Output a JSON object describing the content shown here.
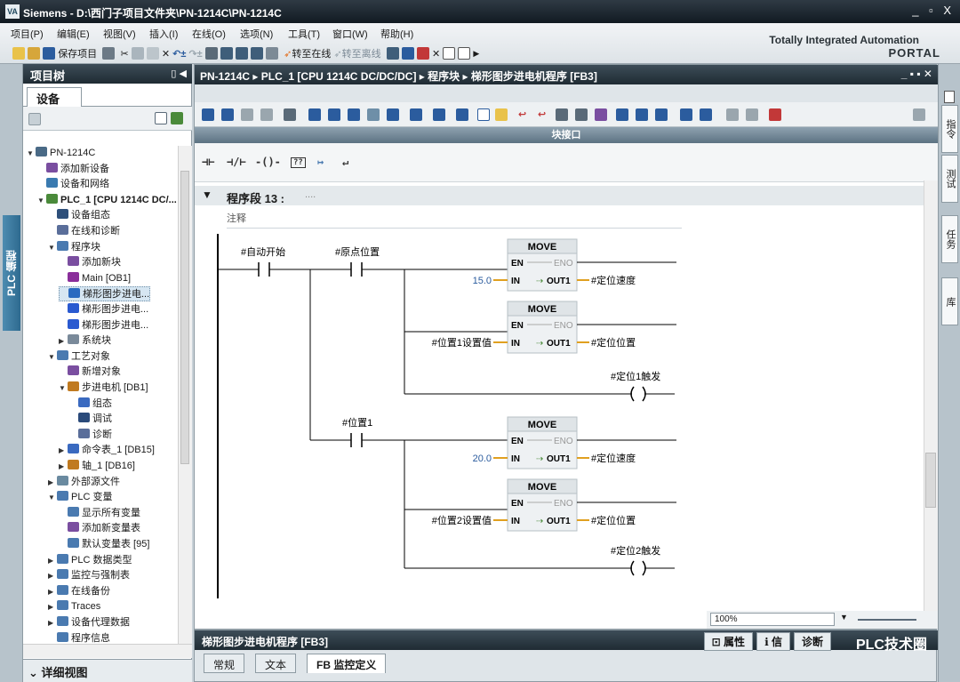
{
  "window": {
    "app": "Siemens",
    "path": "D:\\西门子项目文件夹\\PN-1214C\\PN-1214C",
    "logo": "VA",
    "controls": "_ ▫ X"
  },
  "menu": [
    "项目(P)",
    "编辑(E)",
    "视图(V)",
    "插入(I)",
    "在线(O)",
    "选项(N)",
    "工具(T)",
    "窗口(W)",
    "帮助(H)"
  ],
  "toolbar": {
    "save": "保存项目",
    "go_online": "转至在线",
    "go_offline": "转至离线"
  },
  "portal": {
    "line1": "Totally Integrated Automation",
    "line2": "PORTAL"
  },
  "left_tab": "PLC 编程",
  "tree": {
    "title": "项目树",
    "device_tab": "设备",
    "items": [
      {
        "label": "PN-1214C",
        "indent": 0,
        "toggle": "▼",
        "color": "#4a6a86"
      },
      {
        "label": "添加新设备",
        "indent": 1,
        "toggle": "",
        "color": "#7a4ea0"
      },
      {
        "label": "设备和网络",
        "indent": 1,
        "toggle": "",
        "color": "#3a7ab0"
      },
      {
        "label": "PLC_1 [CPU 1214C DC/...",
        "indent": 1,
        "toggle": "▼",
        "color": "#4a8a3a",
        "bold": true
      },
      {
        "label": "设备组态",
        "indent": 2,
        "toggle": "",
        "color": "#2d4f7a"
      },
      {
        "label": "在线和诊断",
        "indent": 2,
        "toggle": "",
        "color": "#5a6e9a"
      },
      {
        "label": "程序块",
        "indent": 2,
        "toggle": "▼",
        "color": "#4a7ab0"
      },
      {
        "label": "添加新块",
        "indent": 3,
        "toggle": "",
        "color": "#7a4ea0"
      },
      {
        "label": "Main [OB1]",
        "indent": 3,
        "toggle": "",
        "color": "#8a2e9a"
      },
      {
        "label": "梯形图步进电...",
        "indent": 3,
        "toggle": "",
        "color": "#2a6ac0",
        "selected": true
      },
      {
        "label": "梯形图步进电...",
        "indent": 3,
        "toggle": "",
        "color": "#2a5ad0"
      },
      {
        "label": "梯形图步进电...",
        "indent": 3,
        "toggle": "",
        "color": "#2a5ad0"
      },
      {
        "label": "系统块",
        "indent": 3,
        "toggle": "▶",
        "color": "#7a8a9a"
      },
      {
        "label": "工艺对象",
        "indent": 2,
        "toggle": "▼",
        "color": "#4a7ab0"
      },
      {
        "label": "新增对象",
        "indent": 3,
        "toggle": "",
        "color": "#7a4ea0"
      },
      {
        "label": "步进电机 [DB1]",
        "indent": 3,
        "toggle": "▼",
        "color": "#c07a20"
      },
      {
        "label": "组态",
        "indent": 4,
        "toggle": "",
        "color": "#3a6ac0"
      },
      {
        "label": "调试",
        "indent": 4,
        "toggle": "",
        "color": "#2a4a7a"
      },
      {
        "label": "诊断",
        "indent": 4,
        "toggle": "",
        "color": "#5a6e9a"
      },
      {
        "label": "命令表_1 [DB15]",
        "indent": 3,
        "toggle": "▶",
        "color": "#3a6ac0"
      },
      {
        "label": "轴_1 [DB16]",
        "indent": 3,
        "toggle": "▶",
        "color": "#c07a20"
      },
      {
        "label": "外部源文件",
        "indent": 2,
        "toggle": "▶",
        "color": "#6a8aa0"
      },
      {
        "label": "PLC 变量",
        "indent": 2,
        "toggle": "▼",
        "color": "#4a7ab0"
      },
      {
        "label": "显示所有变量",
        "indent": 3,
        "toggle": "",
        "color": "#4a7ab0"
      },
      {
        "label": "添加新变量表",
        "indent": 3,
        "toggle": "",
        "color": "#7a4ea0"
      },
      {
        "label": "默认变量表 [95]",
        "indent": 3,
        "toggle": "",
        "color": "#4a7ab0"
      },
      {
        "label": "PLC 数据类型",
        "indent": 2,
        "toggle": "▶",
        "color": "#4a7ab0"
      },
      {
        "label": "监控与强制表",
        "indent": 2,
        "toggle": "▶",
        "color": "#4a7ab0"
      },
      {
        "label": "在线备份",
        "indent": 2,
        "toggle": "▶",
        "color": "#4a7ab0"
      },
      {
        "label": "Traces",
        "indent": 2,
        "toggle": "▶",
        "color": "#4a7ab0"
      },
      {
        "label": "设备代理数据",
        "indent": 2,
        "toggle": "▶",
        "color": "#4a7ab0"
      },
      {
        "label": "程序信息",
        "indent": 2,
        "toggle": "",
        "color": "#4a7ab0"
      }
    ],
    "detail_view": "详细视图"
  },
  "editor": {
    "breadcrumb": [
      "PN-1214C",
      "PLC_1 [CPU 1214C DC/DC/DC]",
      "程序块",
      "梯形图步进电机程序 [FB3]"
    ],
    "interface": "块接口",
    "network": {
      "title": "程序段 13 :",
      "dots": "....",
      "comment": "注释"
    },
    "contacts": {
      "auto_start": "#自动开始",
      "origin": "#原点位置",
      "pos1": "#位置1"
    },
    "move_blocks": [
      {
        "title": "MOVE",
        "in": "15.0",
        "out": "#定位速度"
      },
      {
        "title": "MOVE",
        "in": "#位置1设置值",
        "out": "#定位位置"
      },
      {
        "title": "MOVE",
        "in": "20.0",
        "out": "#定位速度"
      },
      {
        "title": "MOVE",
        "in": "#位置2设置值",
        "out": "#定位位置"
      }
    ],
    "pins": {
      "en": "EN",
      "eno": "ENO",
      "in": "IN",
      "out": "OUT1"
    },
    "coils": [
      "#定位1触发",
      "#定位2触发"
    ],
    "zoom": "100%"
  },
  "right_tabs": [
    "指令",
    "测试",
    "任务",
    "库"
  ],
  "inspector": {
    "title": "梯形图步进电机程序 [FB3]",
    "props": "属性",
    "info": "信",
    "diag": "诊断",
    "tabs": [
      "常规",
      "文本",
      "FB 监控定义"
    ],
    "watermark": "PLC技术圈"
  }
}
